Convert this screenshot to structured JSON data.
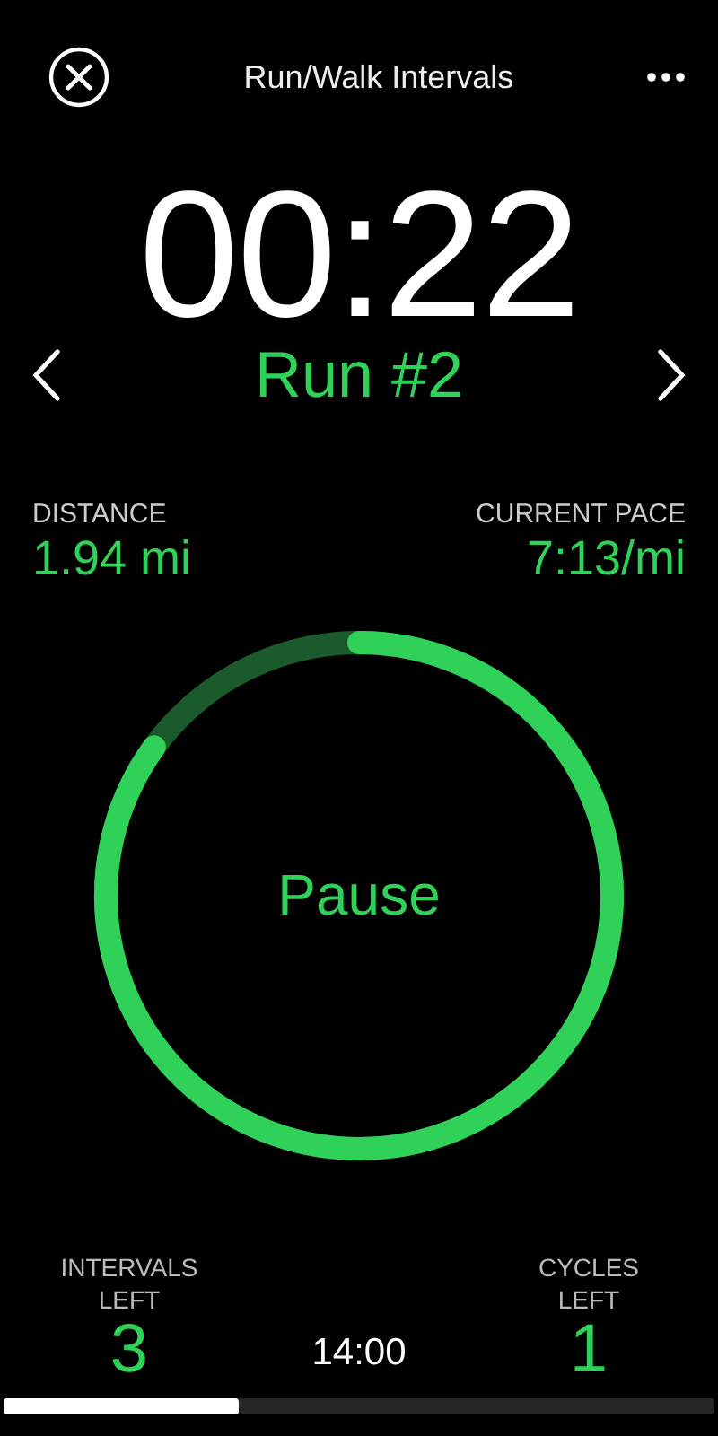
{
  "header": {
    "title": "Run/Walk Intervals"
  },
  "timer": {
    "time": "00:22",
    "interval": "Run #2"
  },
  "stats": [
    {
      "label": "DISTANCE",
      "value": "1.94 mi"
    },
    {
      "label": "CURRENT PACE",
      "value": "7:13/mi"
    }
  ],
  "ring": {
    "label": "Pause"
  },
  "footer": {
    "intervals_left": {
      "label": "INTERVALS LEFT",
      "value": "3"
    },
    "total_time": "14:00",
    "cycles_left": {
      "label": "CYCLES LEFT",
      "value": "1"
    }
  },
  "progress": {
    "level": 0.33
  }
}
